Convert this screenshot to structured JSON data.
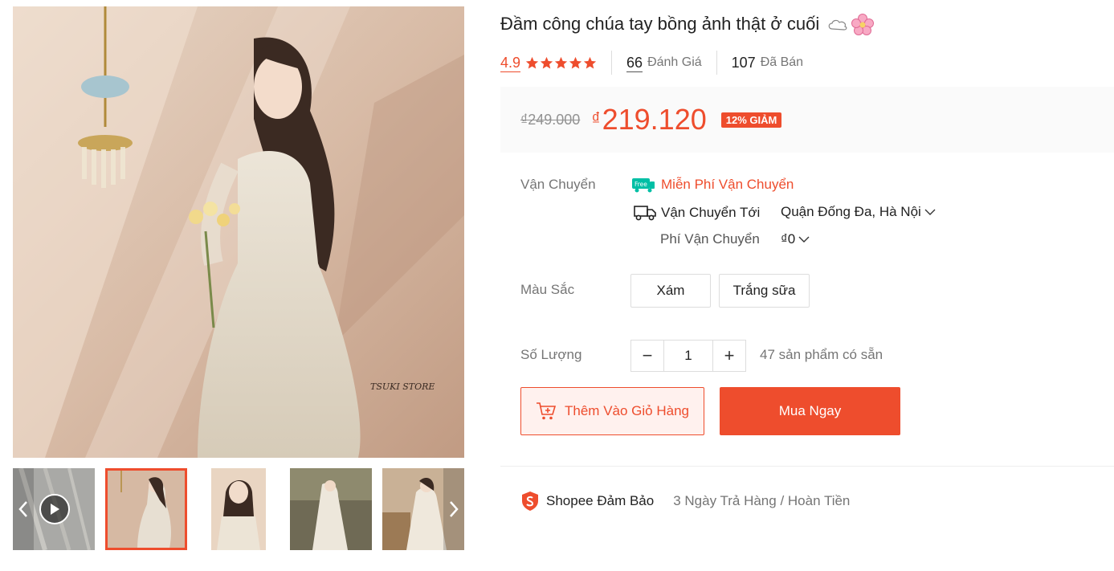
{
  "product": {
    "title": "Đầm công chúa tay bồng ảnh thật ở cuối",
    "title_emojis": [
      "cloud-emoji",
      "cherry-blossom-emoji"
    ],
    "image_watermark": "TSUKI STORE"
  },
  "stats": {
    "rating": "4.9",
    "stars": 5,
    "reviews_count": "66",
    "reviews_label": "Đánh Giá",
    "sold_count": "107",
    "sold_label": "Đã Bán"
  },
  "price": {
    "original": "₫249.000",
    "currency": "₫",
    "current": "219.120",
    "discount_badge": "12% GIẢM",
    "accent_color": "#ee4d2d"
  },
  "shipping": {
    "label": "Vận Chuyển",
    "free_badge": "Free",
    "free_text": "Miễn Phí Vận Chuyển",
    "to_label": "Vận Chuyển Tới",
    "to_value": "Quận Đống Đa, Hà Nội",
    "fee_label": "Phí Vận Chuyển",
    "fee_value": "₫0"
  },
  "variants": {
    "label": "Màu Sắc",
    "options": [
      "Xám",
      "Trắng sữa"
    ]
  },
  "quantity": {
    "label": "Số Lượng",
    "minus": "−",
    "value": "1",
    "plus": "+",
    "stock": "47 sản phẩm có sẵn"
  },
  "actions": {
    "add_to_cart": "Thêm Vào Giỏ Hàng",
    "buy_now": "Mua Ngay"
  },
  "guarantee": {
    "brand": "Shopee Đảm Bảo",
    "policy": "3 Ngày Trả Hàng / Hoàn Tiền"
  },
  "gallery": {
    "thumb_count": 5,
    "active_index": 1,
    "icons": [
      "chevron-left-icon",
      "chevron-right-icon",
      "play-icon"
    ]
  }
}
